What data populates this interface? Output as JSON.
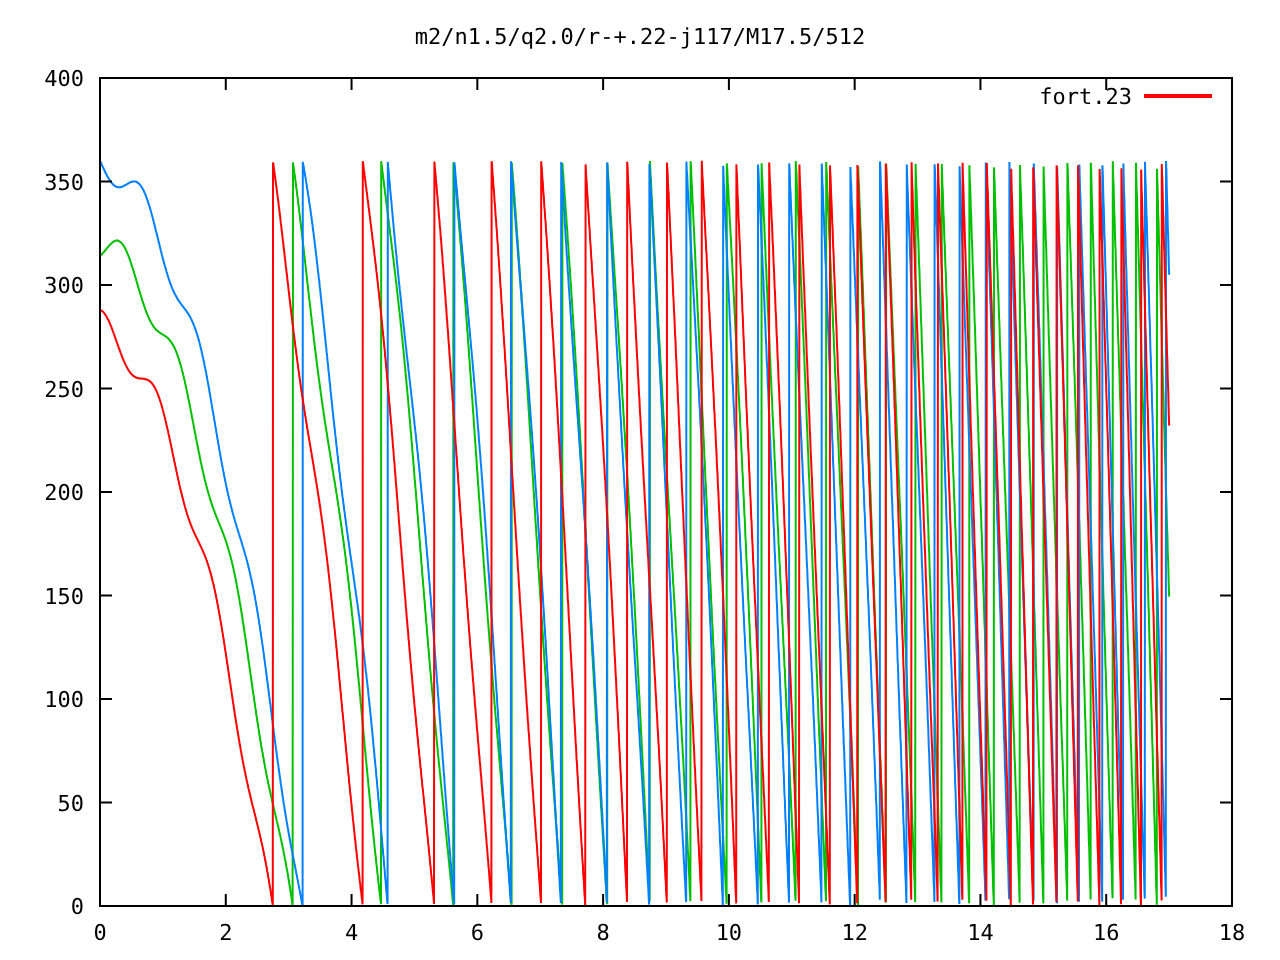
{
  "plot": {
    "title": "m2/n1.5/q2.0/r-+.22-j117/M17.5/512",
    "y_axis_labels": [
      "400",
      "350",
      "300",
      "250",
      "200",
      "150",
      "100",
      "50",
      "0"
    ],
    "x_axis_labels": [
      "0",
      "2",
      "4",
      "6",
      "8",
      "10",
      "12",
      "14",
      "16",
      "18"
    ],
    "legend": [
      {
        "label": "fort.23",
        "color": "#ff0000"
      }
    ]
  }
}
